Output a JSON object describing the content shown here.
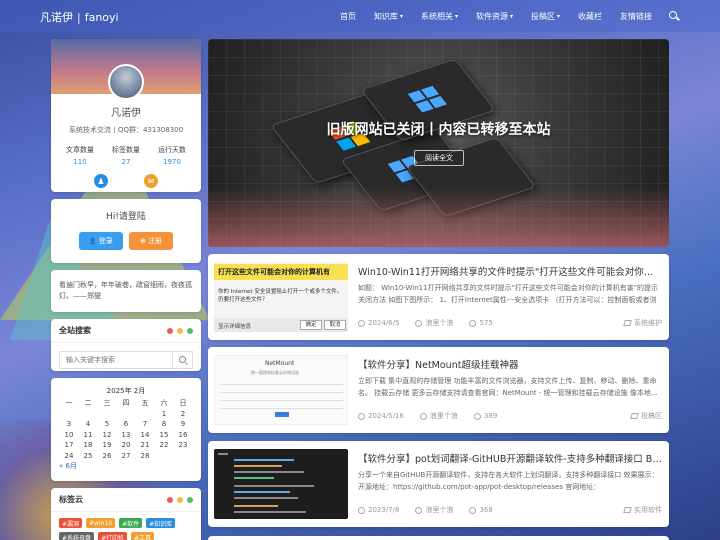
{
  "header": {
    "logo": "凡诺伊",
    "logo_sep": "|",
    "logo_en": "fanoyi",
    "nav": [
      {
        "label": "首页",
        "has_menu": false
      },
      {
        "label": "知识库",
        "has_menu": true
      },
      {
        "label": "系统相关",
        "has_menu": true
      },
      {
        "label": "软件资源",
        "has_menu": true
      },
      {
        "label": "投稿区",
        "has_menu": true
      },
      {
        "label": "收藏栏",
        "has_menu": false
      },
      {
        "label": "友情链接",
        "has_menu": false
      }
    ],
    "chevron": "▾",
    "search_icon": "search-icon"
  },
  "profile": {
    "name": "凡诺伊",
    "desc": "系统技术交流丨QQ群：431308300",
    "stats": [
      {
        "label": "文章数量",
        "value": "110"
      },
      {
        "label": "标签数量",
        "value": "27"
      },
      {
        "label": "运行天数",
        "value": "1970"
      }
    ],
    "qq_icon": "♟",
    "mail_icon": "✉"
  },
  "login": {
    "title": "Hi!请登陆",
    "login_label": "登录",
    "register_label": "注册",
    "login_icon": "👤",
    "register_icon": "⊕"
  },
  "quote": "看遍门秋早，年年破巷，疏窗细雨，夜夜孤灯。——郑燮",
  "search_widget": {
    "title": "全站搜索",
    "placeholder": "输入关键字搜索"
  },
  "calendar": {
    "caption": "2025年 2月",
    "weekdays": [
      "一",
      "二",
      "三",
      "四",
      "五",
      "六",
      "日"
    ],
    "weeks": [
      [
        "",
        "",
        "",
        "",
        "",
        "1",
        "2"
      ],
      [
        "3",
        "4",
        "5",
        "6",
        "7",
        "8",
        "9"
      ],
      [
        "10",
        "11",
        "12",
        "13",
        "14",
        "15",
        "16"
      ],
      [
        "17",
        "18",
        "19",
        "20",
        "21",
        "22",
        "23"
      ],
      [
        "24",
        "25",
        "26",
        "27",
        "28",
        "",
        ""
      ]
    ],
    "prev": "« 6月"
  },
  "tags_widget": {
    "title": "标签云",
    "tags": [
      {
        "label": "#漏洞",
        "color": "#e8503a"
      },
      {
        "label": "#win10",
        "color": "#f0a030"
      },
      {
        "label": "#软件",
        "color": "#3aaa50"
      },
      {
        "label": "#知识库",
        "color": "#2a8ee0"
      },
      {
        "label": "#系统母盘",
        "color": "#666666"
      },
      {
        "label": "#打印机",
        "color": "#e8503a"
      },
      {
        "label": "#工具",
        "color": "#f0a030"
      }
    ]
  },
  "hero": {
    "title": "旧版网站已关闭丨内容已转移至本站",
    "button": "阅读全文"
  },
  "posts": [
    {
      "title": "Win10-Win11打开网络共享的文件时提示\"打开这些文件可能会对你的计算机有害\"的...",
      "excerpt": "如题： Win10-Win11打开网络共享的文件时提示\"打开这些文件可能会对你的计算机有害\"的提示关闭方法 如图下图所示： 1、打开Internet属性---安全选项卡 （打开方法可以：控制面板或者浏览...",
      "date": "2024/6/5",
      "author": "浪里个浪",
      "views": "575",
      "category": "系统维护",
      "thumb": {
        "banner": "打开这些文件可能会对你的计算机有",
        "text": "你的 Internet 安全设置阻止打开一个或多个文件。仍要打开这些文件？",
        "link": "显示详细信息",
        "ok": "确定",
        "cancel": "取消"
      }
    },
    {
      "title": "【软件分享】NetMount超级挂载神器",
      "excerpt": "立即下载 集中直观的存储管理 功能丰富的文件浏览器，支持文件上传、复制、移动、删除、重命名。 挂载云存储 更多云存储支持请查看官网：NetMount - 统一管理和挂载云存储设施  像本地...",
      "date": "2024/5/16",
      "author": "浪里个浪",
      "views": "389",
      "category": "投稿区",
      "thumb": {
        "logo": "NetMount",
        "sub": "统一管理和挂载云存储设施"
      }
    },
    {
      "title": "【软件分享】pot划词翻译-GitHUB开源翻译软件-支持多种翻译接口 By...",
      "excerpt": "分享一个来自GitHUB开源翻译软件，支持在各大软件上划词翻译，支持多种翻译接口 效果展示：开源地址：https://github.com/pot-app/pot-desktop/releases 官网地址：https://pot.pylogmon.co...",
      "date": "2023/7/8",
      "author": "浪里个浪",
      "views": "368",
      "category": "实用软件"
    }
  ],
  "colors": {
    "accent": "#2a8ee0",
    "orange": "#f5913a",
    "win_blue": "#4aa8ff",
    "win_red": "#f25022",
    "win_green": "#7fba00",
    "win_yellow": "#ffb900"
  }
}
